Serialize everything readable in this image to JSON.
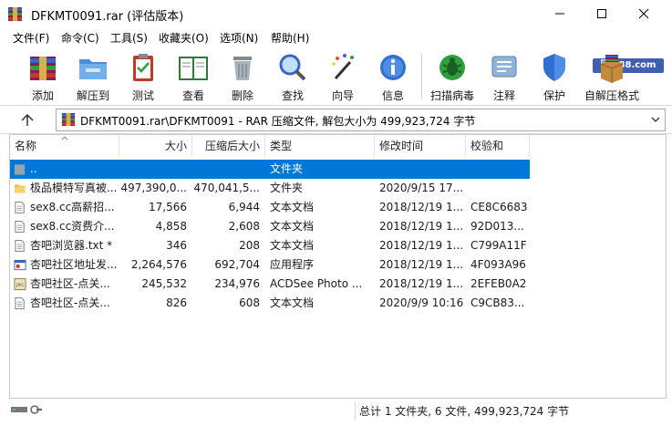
{
  "window": {
    "title": "DFKMT0091.rar (评估版本)",
    "watermark": "回家88.com"
  },
  "menu": [
    "文件(F)",
    "命令(C)",
    "工具(S)",
    "收藏夹(O)",
    "选项(N)",
    "帮助(H)"
  ],
  "toolbar": [
    {
      "label": "添加",
      "icon": "add-archive-icon"
    },
    {
      "label": "解压到",
      "icon": "extract-folder-icon"
    },
    {
      "label": "测试",
      "icon": "test-clipboard-icon"
    },
    {
      "label": "查看",
      "icon": "view-book-icon"
    },
    {
      "label": "删除",
      "icon": "trash-icon"
    },
    {
      "label": "查找",
      "icon": "magnifier-icon"
    },
    {
      "label": "向导",
      "icon": "wizard-wand-icon"
    },
    {
      "label": "信息",
      "icon": "info-icon"
    },
    {
      "label": "扫描病毒",
      "icon": "virus-scan-icon"
    },
    {
      "label": "注释",
      "icon": "comment-icon"
    },
    {
      "label": "保护",
      "icon": "shield-icon"
    },
    {
      "label": "自解压格式",
      "icon": "sfx-box-icon"
    }
  ],
  "address": {
    "path": "DFKMT0091.rar\\DFKMT0091 - RAR 压缩文件, 解包大小为 499,923,724 字节"
  },
  "columns": [
    "名称",
    "大小",
    "压缩后大小",
    "类型",
    "修改时间",
    "校验和"
  ],
  "files": [
    {
      "name": "..",
      "size": "",
      "packed": "",
      "type": "文件夹",
      "modified": "",
      "crc": "",
      "icon": "parent-folder-icon",
      "selected": true
    },
    {
      "name": "极品模特写真被...",
      "size": "497,390,0...",
      "packed": "470,041,5...",
      "type": "文件夹",
      "modified": "2020/9/15 17...",
      "crc": "",
      "icon": "folder-icon",
      "selected": false
    },
    {
      "name": "sex8.cc高薪招...",
      "size": "17,566",
      "packed": "6,944",
      "type": "文本文档",
      "modified": "2018/12/19 1...",
      "crc": "CE8C6683",
      "icon": "text-file-icon",
      "selected": false
    },
    {
      "name": "sex8.cc资费介...",
      "size": "4,858",
      "packed": "2,608",
      "type": "文本文档",
      "modified": "2018/12/19 1...",
      "crc": "92D013...",
      "icon": "text-file-icon",
      "selected": false
    },
    {
      "name": "杏吧浏览器.txt *",
      "size": "346",
      "packed": "208",
      "type": "文本文档",
      "modified": "2018/12/19 1...",
      "crc": "C799A11F",
      "icon": "text-file-icon",
      "selected": false
    },
    {
      "name": "杏吧社区地址发...",
      "size": "2,264,576",
      "packed": "692,704",
      "type": "应用程序",
      "modified": "2018/12/19 1...",
      "crc": "4F093A96",
      "icon": "exe-file-icon",
      "selected": false
    },
    {
      "name": "杏吧社区-点关...",
      "size": "245,532",
      "packed": "234,976",
      "type": "ACDSee Photo ...",
      "modified": "2018/12/19 1...",
      "crc": "2EFEB0A2",
      "icon": "jpg-file-icon",
      "selected": false
    },
    {
      "name": "杏吧社区-点关...",
      "size": "826",
      "packed": "608",
      "type": "文本文档",
      "modified": "2020/9/9 10:16",
      "crc": "C9CB83...",
      "icon": "text-file-icon",
      "selected": false
    }
  ],
  "status": {
    "summary": "总计 1 文件夹, 6 文件, 499,923,724 字节"
  }
}
